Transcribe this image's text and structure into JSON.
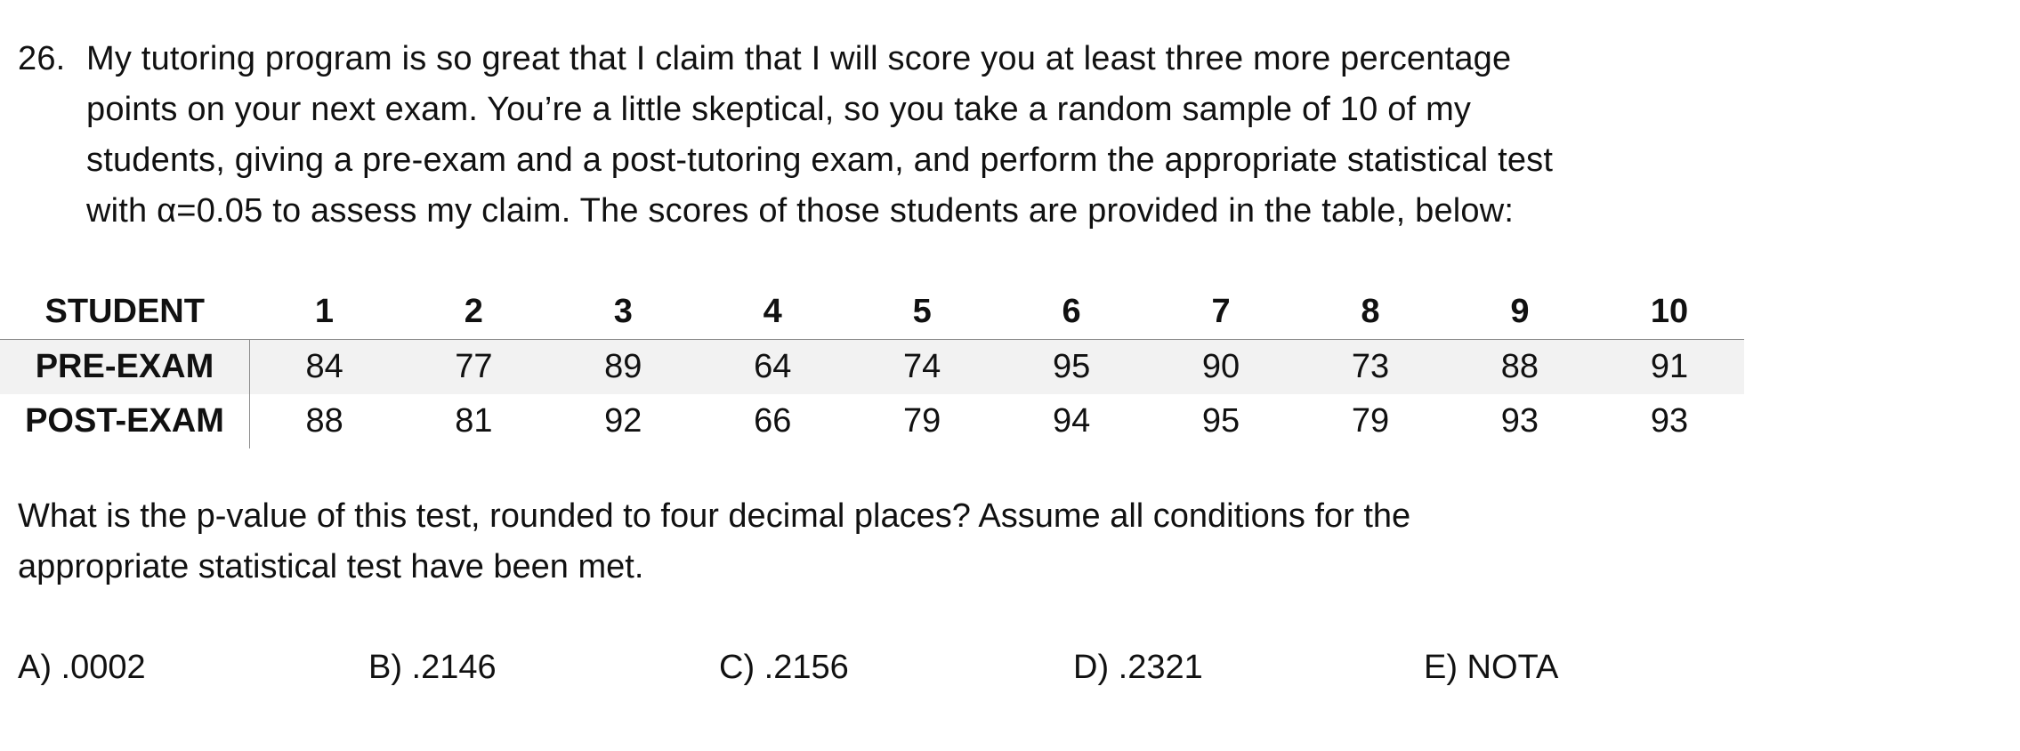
{
  "question": {
    "number": "26.",
    "lines": [
      "My tutoring program is so great that I claim that I will score you at least three more percentage",
      "points on your next exam. You’re a little skeptical, so you take a random sample of 10 of my",
      "students, giving a pre-exam and a post-tutoring exam, and perform the appropriate statistical test",
      "with α=0.05 to assess my claim. The scores of those students are provided in the table, below:"
    ]
  },
  "table": {
    "header_label": "STUDENT",
    "students": [
      "1",
      "2",
      "3",
      "4",
      "5",
      "6",
      "7",
      "8",
      "9",
      "10"
    ],
    "rows": [
      {
        "label": "PRE-EXAM",
        "values": [
          "84",
          "77",
          "89",
          "64",
          "74",
          "95",
          "90",
          "73",
          "88",
          "91"
        ]
      },
      {
        "label": "POST-EXAM",
        "values": [
          "88",
          "81",
          "92",
          "66",
          "79",
          "94",
          "95",
          "79",
          "93",
          "93"
        ]
      }
    ]
  },
  "prompt": {
    "lines": [
      "What is the p-value of this test, rounded to four decimal places? Assume all conditions for the",
      "appropriate statistical test have been met."
    ]
  },
  "answers": [
    {
      "label": "A) .0002"
    },
    {
      "label": "B) .2146"
    },
    {
      "label": "C) .2156"
    },
    {
      "label": "D) .2321"
    },
    {
      "label": "E) NOTA"
    }
  ]
}
